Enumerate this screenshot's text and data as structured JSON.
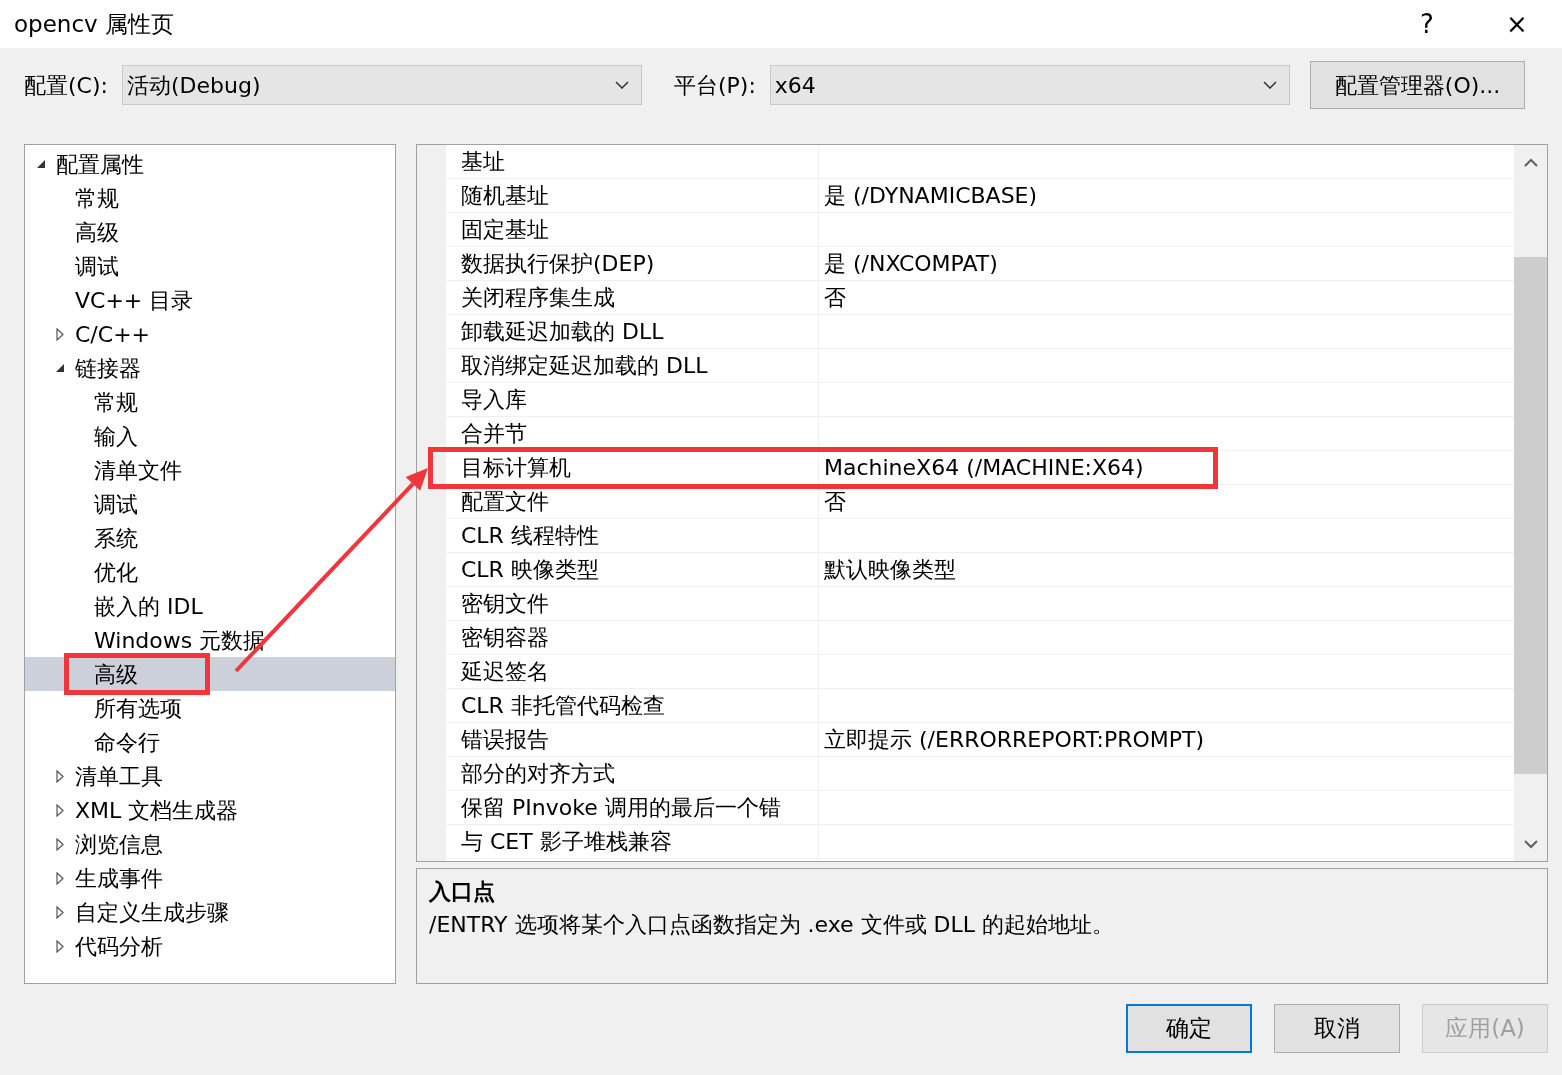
{
  "window": {
    "title": "opencv 属性页",
    "help_button": "?",
    "close_button": "×"
  },
  "configuration": {
    "label": "配置(C):",
    "value": "活动(Debug)"
  },
  "platform": {
    "label": "平台(P):",
    "value": "x64"
  },
  "config_manager_button": "配置管理器(O)...",
  "tree": [
    {
      "label": "配置属性",
      "expanded": true,
      "selected": false,
      "children": [
        {
          "label": "常规",
          "selected": false
        },
        {
          "label": "高级",
          "selected": false
        },
        {
          "label": "调试",
          "selected": false
        },
        {
          "label": "VC++ 目录",
          "selected": false
        },
        {
          "label": "C/C++",
          "expanded": false,
          "selected": false
        },
        {
          "label": "链接器",
          "expanded": true,
          "selected": false,
          "children": [
            {
              "label": "常规",
              "selected": false
            },
            {
              "label": "输入",
              "selected": false
            },
            {
              "label": "清单文件",
              "selected": false
            },
            {
              "label": "调试",
              "selected": false
            },
            {
              "label": "系统",
              "selected": false
            },
            {
              "label": "优化",
              "selected": false
            },
            {
              "label": "嵌入的 IDL",
              "selected": false
            },
            {
              "label": "Windows 元数据",
              "selected": false
            },
            {
              "label": "高级",
              "selected": true,
              "annotated": true
            },
            {
              "label": "所有选项",
              "selected": false
            },
            {
              "label": "命令行",
              "selected": false
            }
          ]
        },
        {
          "label": "清单工具",
          "expanded": false,
          "selected": false
        },
        {
          "label": "XML 文档生成器",
          "expanded": false,
          "selected": false
        },
        {
          "label": "浏览信息",
          "expanded": false,
          "selected": false
        },
        {
          "label": "生成事件",
          "expanded": false,
          "selected": false
        },
        {
          "label": "自定义生成步骤",
          "expanded": false,
          "selected": false
        },
        {
          "label": "代码分析",
          "expanded": false,
          "selected": false
        }
      ]
    }
  ],
  "properties": [
    {
      "name": "基址"
    },
    {
      "name": "随机基址",
      "value": "是 (/DYNAMICBASE)"
    },
    {
      "name": "固定基址"
    },
    {
      "name": "数据执行保护(DEP)",
      "value": "是 (/NXCOMPAT)"
    },
    {
      "name": "关闭程序集生成",
      "value": "否"
    },
    {
      "name": "卸载延迟加载的 DLL"
    },
    {
      "name": "取消绑定延迟加载的 DLL"
    },
    {
      "name": "导入库"
    },
    {
      "name": "合并节"
    },
    {
      "name": "目标计算机",
      "value": "MachineX64 (/MACHINE:X64)",
      "annotated": true
    },
    {
      "name": "配置文件",
      "value": "否"
    },
    {
      "name": "CLR 线程特性"
    },
    {
      "name": "CLR 映像类型",
      "value": "默认映像类型"
    },
    {
      "name": "密钥文件"
    },
    {
      "name": "密钥容器"
    },
    {
      "name": "延迟签名"
    },
    {
      "name": "CLR 非托管代码检查"
    },
    {
      "name": "错误报告",
      "value": "立即提示 (/ERRORREPORT:PROMPT)"
    },
    {
      "name": "部分的对齐方式"
    },
    {
      "name": "保留 PInvoke 调用的最后一个错"
    },
    {
      "name": "与 CET 影子堆栈兼容"
    }
  ],
  "description": {
    "title": "入口点",
    "text": "/ENTRY 选项将某个入口点函数指定为 .exe 文件或 DLL 的起始地址。"
  },
  "buttons": [
    {
      "label": "确定",
      "kind": "default",
      "disabled": false
    },
    {
      "label": "取消",
      "kind": "normal",
      "disabled": false
    },
    {
      "label": "应用(A)",
      "kind": "normal",
      "disabled": true
    }
  ]
}
